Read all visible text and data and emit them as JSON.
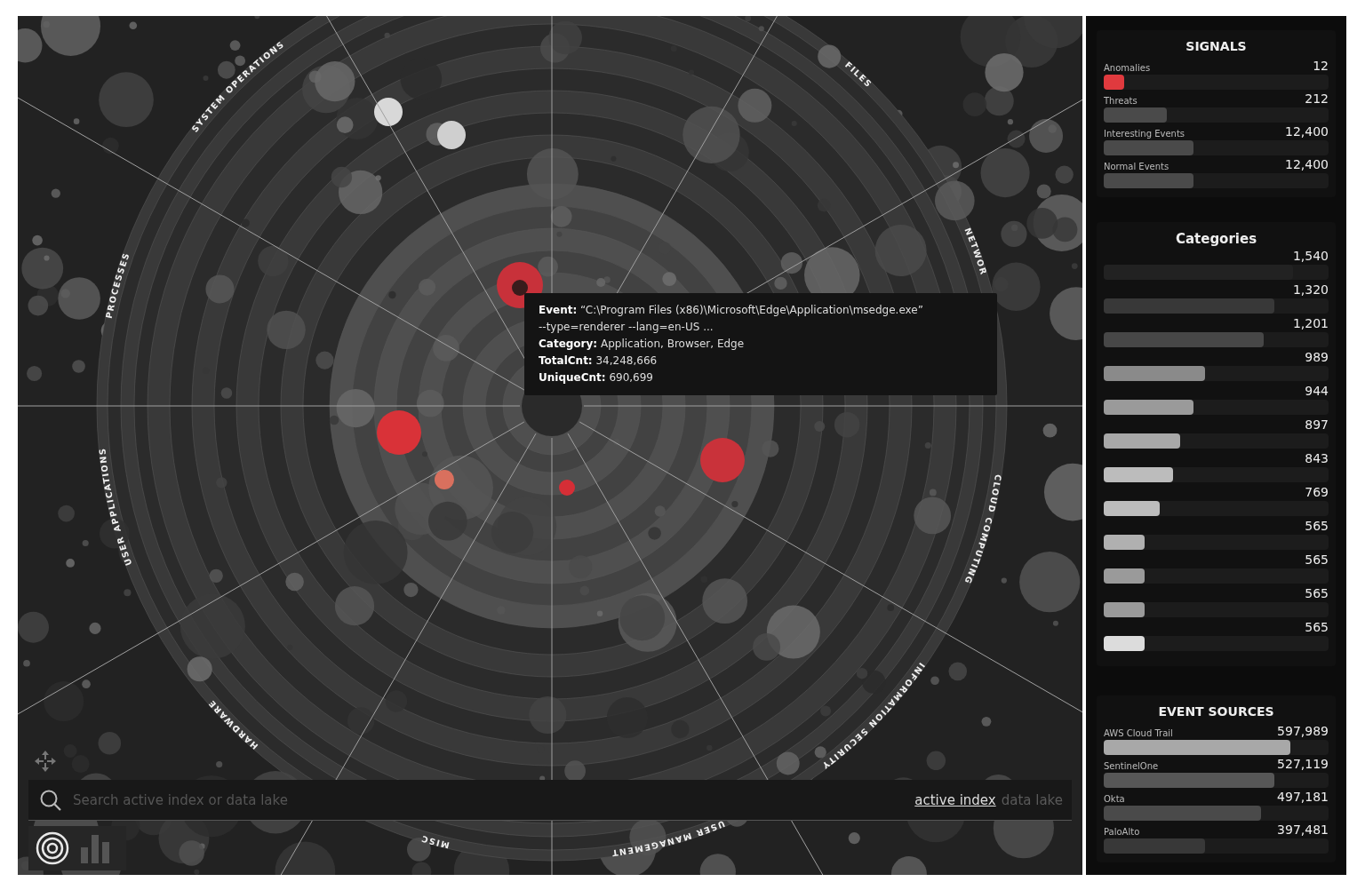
{
  "chart": {
    "sector_labels": [
      {
        "text": "SYSTEM OPERATIONS"
      },
      {
        "text": "FILES"
      },
      {
        "text": "NETWOR"
      },
      {
        "text": "PROCESSES"
      },
      {
        "text": "USER APPLICATIONS"
      },
      {
        "text": "CLOUD COMPUTING"
      },
      {
        "text": "INFORMATION SECURITY"
      },
      {
        "text": "HARDWARE"
      },
      {
        "text": "MISC"
      },
      {
        "text": "USER MANAGEMENT"
      }
    ]
  },
  "tooltip": {
    "lines": [
      "**Event:** “C:\\Program Files (x86)\\Microsoft\\Edge\\Application\\msedge.exe”",
      "--type=renderer --lang=en-US ...",
      "**Category:** Application, Browser, Edge",
      "**TotalCnt:** 34,248,666",
      "**UniqueCnt:** 690,699"
    ]
  },
  "search": {
    "placeholder": "Search active index or data lake",
    "scopes": [
      {
        "label": "active index",
        "selected": true
      },
      {
        "label": "data lake",
        "selected": false
      }
    ]
  },
  "views": [
    {
      "kind": "radial",
      "selected": true
    },
    {
      "kind": "bars",
      "selected": false
    }
  ],
  "signals": {
    "title": "SIGNALS",
    "items": [
      {
        "label": "Anomalies",
        "value": "12",
        "level": 0.09,
        "color": "#e03a3e"
      },
      {
        "label": "Threats",
        "value": "212",
        "level": 0.28,
        "color": "#4a4a4a"
      },
      {
        "label": "Interesting Events",
        "value": "12,400",
        "level": 0.4,
        "color": "#4a4a4a"
      },
      {
        "label": "Normal Events",
        "value": "12,400",
        "level": 0.4,
        "color": "#4a4a4a"
      }
    ]
  },
  "categories": {
    "title": "Categories",
    "items": [
      {
        "value": "1,540",
        "level": 0.84,
        "color": "#222222"
      },
      {
        "value": "1,320",
        "level": 0.76,
        "color": "#383838"
      },
      {
        "value": "1,201",
        "level": 0.71,
        "color": "#474747"
      },
      {
        "value": "989",
        "level": 0.45,
        "color": "#8a8a8a"
      },
      {
        "value": "944",
        "level": 0.4,
        "color": "#9a9a9a"
      },
      {
        "value": "897",
        "level": 0.34,
        "color": "#a8a8a8"
      },
      {
        "value": "843",
        "level": 0.31,
        "color": "#bcbcbc"
      },
      {
        "value": "769",
        "level": 0.25,
        "color": "#bcbcbc"
      },
      {
        "value": "565",
        "level": 0.18,
        "color": "#b0b0b0"
      },
      {
        "value": "565",
        "level": 0.18,
        "color": "#9a9a9a"
      },
      {
        "value": "565",
        "level": 0.18,
        "color": "#9a9a9a"
      },
      {
        "value": "565",
        "level": 0.18,
        "color": "#dcdcdc"
      }
    ]
  },
  "event_sources": {
    "title": "EVENT SOURCES",
    "items": [
      {
        "label": "AWS Cloud Trail",
        "value": "597,989",
        "level": 0.83,
        "color": "#a8a8a8"
      },
      {
        "label": "SentinelOne",
        "value": "527,119",
        "level": 0.76,
        "color": "#575757"
      },
      {
        "label": "Okta",
        "value": "497,181",
        "level": 0.7,
        "color": "#4a4a4a"
      },
      {
        "label": "PaloAlto",
        "value": "397,481",
        "level": 0.45,
        "color": "#383838"
      }
    ]
  }
}
